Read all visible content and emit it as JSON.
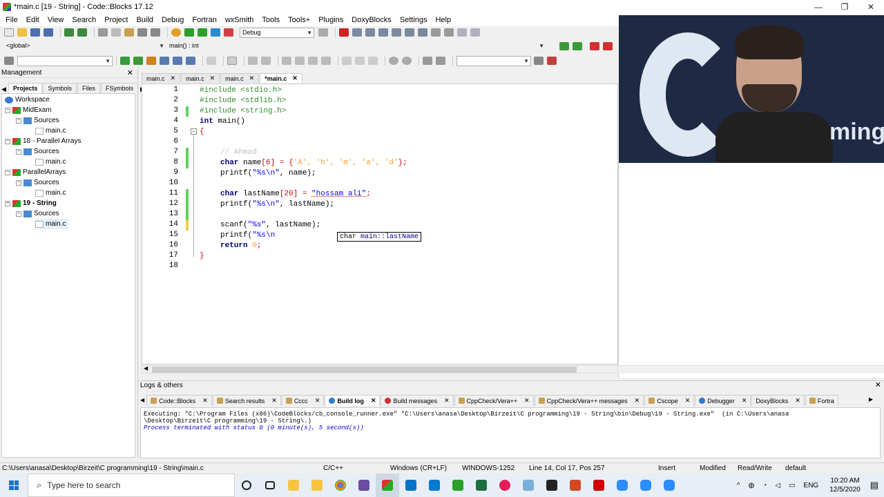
{
  "window": {
    "title": "*main.c [19 - String] - Code::Blocks 17.12",
    "min": "—",
    "max": "❐",
    "close": "✕"
  },
  "menu": [
    "File",
    "Edit",
    "View",
    "Search",
    "Project",
    "Build",
    "Debug",
    "Fortran",
    "wxSmith",
    "Tools",
    "Tools+",
    "Plugins",
    "DoxyBlocks",
    "Settings",
    "Help"
  ],
  "toolbar": {
    "build_target": "Debug",
    "scope": "<global>",
    "function": "main() : int"
  },
  "management": {
    "title": "Management",
    "tabs": [
      "Projects",
      "Symbols",
      "Files",
      "FSymbols"
    ],
    "tree": [
      "Workspace",
      "MidExam",
      "Sources",
      "main.c",
      "18 - Parallel Arrays",
      "Sources",
      "main.c",
      "ParallelArrays",
      "Sources",
      "main.c",
      "19 - String",
      "Sources",
      "main.c"
    ]
  },
  "editor": {
    "tabs": [
      "main.c",
      "main.c",
      "main.c",
      "*main.c"
    ],
    "line_numbers": [
      "1",
      "2",
      "3",
      "4",
      "5",
      "6",
      "7",
      "8",
      "9",
      "10",
      "11",
      "12",
      "13",
      "14",
      "15",
      "16",
      "17",
      "18"
    ],
    "code": {
      "l1": "#include <stdio.h>",
      "l2": "#include <stdlib.h>",
      "l3": "#include <string.h>",
      "l4a": "int",
      "l4b": " main()",
      "l5": "{",
      "l7": "// Ahmad",
      "l8a": "char",
      "l8b": " name",
      "l8c": "[6]",
      "l8d": " = {",
      "l8e": "'A', 'h', 'm', 'a', 'd'",
      "l8f": "};",
      "l9a": "printf(",
      "l9b": "\"%s\\n\"",
      "l9c": ", name);",
      "l11a": "char",
      "l11b": " lastName",
      "l11c": "[20]",
      "l11d": " = ",
      "l11e": "\"hossam ali\"",
      "l11f": ";",
      "l12a": "printf(",
      "l12b": "\"%s\\n\"",
      "l12c": ", lastName);",
      "l14a": "scanf(",
      "l14b": "\"%s\"",
      "l14c": ", lastName);",
      "l15a": "printf(",
      "l15b": "\"%s\\n",
      "l16a": "return",
      "l16b": " 0",
      "l16c": ";",
      "l17": "}"
    },
    "tooltip_type": "char",
    "tooltip_name": " main::lastName"
  },
  "logs": {
    "title": "Logs & others",
    "tabs": [
      "Code::Blocks",
      "Search results",
      "Cccc",
      "Build log",
      "Build messages",
      "CppCheck/Vera++",
      "CppCheck/Vera++ messages",
      "Cscope",
      "Debugger",
      "DoxyBlocks",
      "Fortra"
    ],
    "line1": "Executing: \"C:\\Program Files (x86)\\CodeBlocks/cb_console_runner.exe\" \"C:\\Users\\anasa\\Desktop\\Birzeit\\C programming\\19 - String\\bin\\Debug\\19 - String.exe\"  (in C:\\Users\\anasa",
    "line2": "\\Desktop\\Birzeit\\C programming\\19 - String\\.)",
    "line3": "Process terminated with status 0 (0 minute(s), 5 second(s))"
  },
  "status": {
    "path": "C:\\Users\\anasa\\Desktop\\Birzeit\\C programming\\19 - String\\main.c",
    "lang": "C/C++",
    "eol": "Windows (CR+LF)",
    "encoding": "WINDOWS-1252",
    "position": "Line 14, Col 17, Pos 257",
    "mode": "Insert",
    "modified": "Modified",
    "rw": "Read/Write",
    "profile": "default"
  },
  "taskbar": {
    "search_placeholder": "Type here to search",
    "lang": "ENG",
    "time": "10:20 AM",
    "date": "12/5/2020"
  },
  "webcam": {
    "overlay_text": "ming"
  }
}
